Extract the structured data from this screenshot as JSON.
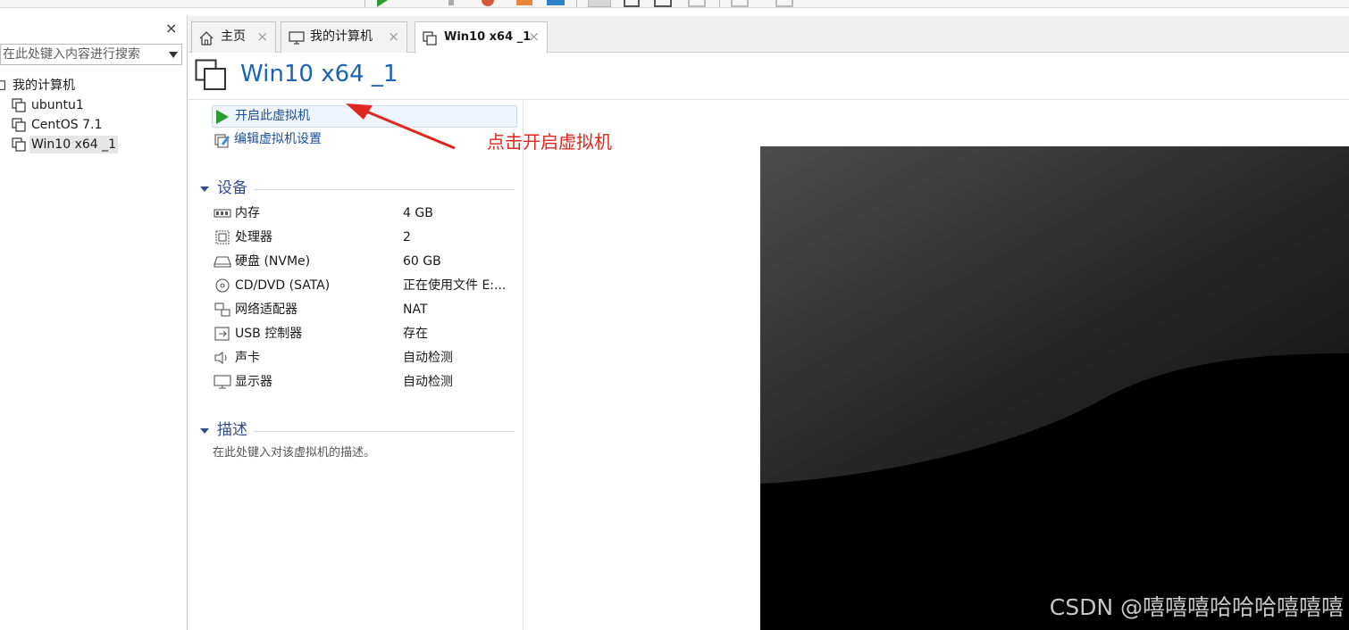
{
  "library": {
    "close_glyph": "×",
    "search_placeholder": "在此处键入内容进行搜索",
    "tree": {
      "root": "我的计算机",
      "vms": [
        "ubuntu1",
        "CentOS 7.1",
        "Win10 x64 _1"
      ]
    }
  },
  "tabs": [
    {
      "label": "主页",
      "icon": "home-icon",
      "close": "×"
    },
    {
      "label": "我的计算机",
      "icon": "computer-icon",
      "close": "×"
    },
    {
      "label": "Win10 x64 _1",
      "icon": "vm-icon",
      "close": "×"
    }
  ],
  "vm": {
    "title": "Win10 x64 _1",
    "actions": {
      "power_on": "开启此虚拟机",
      "edit_settings": "编辑虚拟机设置"
    },
    "devices_header": "设备",
    "devices": [
      {
        "name": "内存",
        "value": "4 GB",
        "icon": "memory-icon"
      },
      {
        "name": "处理器",
        "value": "2",
        "icon": "cpu-icon"
      },
      {
        "name": "硬盘 (NVMe)",
        "value": "60 GB",
        "icon": "disk-icon"
      },
      {
        "name": "CD/DVD (SATA)",
        "value": "正在使用文件 E:...",
        "icon": "cd-icon"
      },
      {
        "name": "网络适配器",
        "value": "NAT",
        "icon": "network-icon"
      },
      {
        "name": "USB 控制器",
        "value": "存在",
        "icon": "usb-icon"
      },
      {
        "name": "声卡",
        "value": "自动检测",
        "icon": "sound-icon"
      },
      {
        "name": "显示器",
        "value": "自动检测",
        "icon": "monitor-icon"
      }
    ],
    "description_header": "描述",
    "description_placeholder": "在此处键入对该虚拟机的描述。"
  },
  "annotation": {
    "text": "点击开启虚拟机",
    "color": "#e0271f"
  },
  "watermark": "CSDN @嘻嘻嘻哈哈哈嘻嘻嘻",
  "colors": {
    "title_blue": "#1a64b4",
    "section_blue": "#314c8a",
    "link_blue": "#1b4f9c",
    "play_green": "#2e9b2e"
  }
}
